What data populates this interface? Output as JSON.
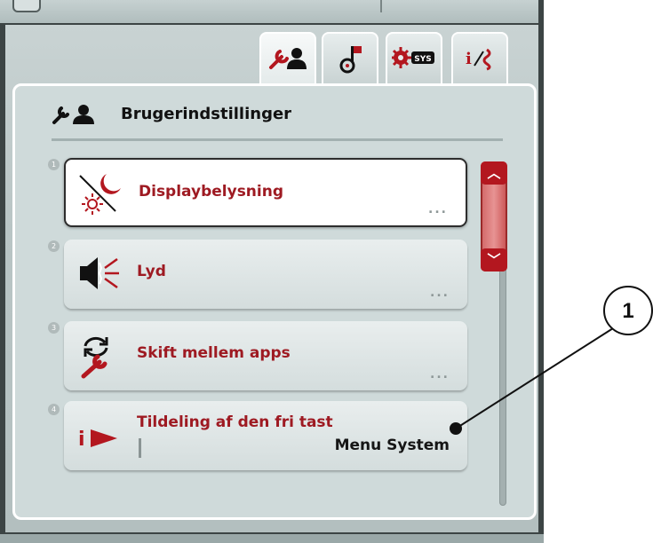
{
  "tabs": [
    {
      "name": "user-settings",
      "icon": "wrench-user-icon",
      "active": true
    },
    {
      "name": "sensors",
      "icon": "probe-flag-icon",
      "active": false
    },
    {
      "name": "system-settings",
      "icon": "gear-sys-icon",
      "icon_text": "SYS",
      "active": false
    },
    {
      "name": "info-diagnostics",
      "icon": "info-diagnostics-icon",
      "active": false
    }
  ],
  "header": {
    "title": "Brugerindstillinger",
    "icon": "wrench-user-icon"
  },
  "menu_items": [
    {
      "number": "1",
      "label": "Displaybelysning",
      "icon": "display-brightness-icon",
      "selected": true,
      "more": "..."
    },
    {
      "number": "2",
      "label": "Lyd",
      "icon": "speaker-icon",
      "selected": false,
      "more": "..."
    },
    {
      "number": "3",
      "label": "Skift mellem apps",
      "icon": "app-switch-icon",
      "selected": false,
      "more": "..."
    },
    {
      "number": "4",
      "label": "Tildeling af den fri tast",
      "value": "Menu System",
      "icon": "info-arrow-icon",
      "selected": false
    }
  ],
  "scrollbar": {
    "up_icon": "chevron-up-icon",
    "down_icon": "chevron-down-icon"
  },
  "callout": {
    "number": "1"
  },
  "colors": {
    "accent_red": "#9e1a22",
    "scroll_red": "#b3171f"
  }
}
